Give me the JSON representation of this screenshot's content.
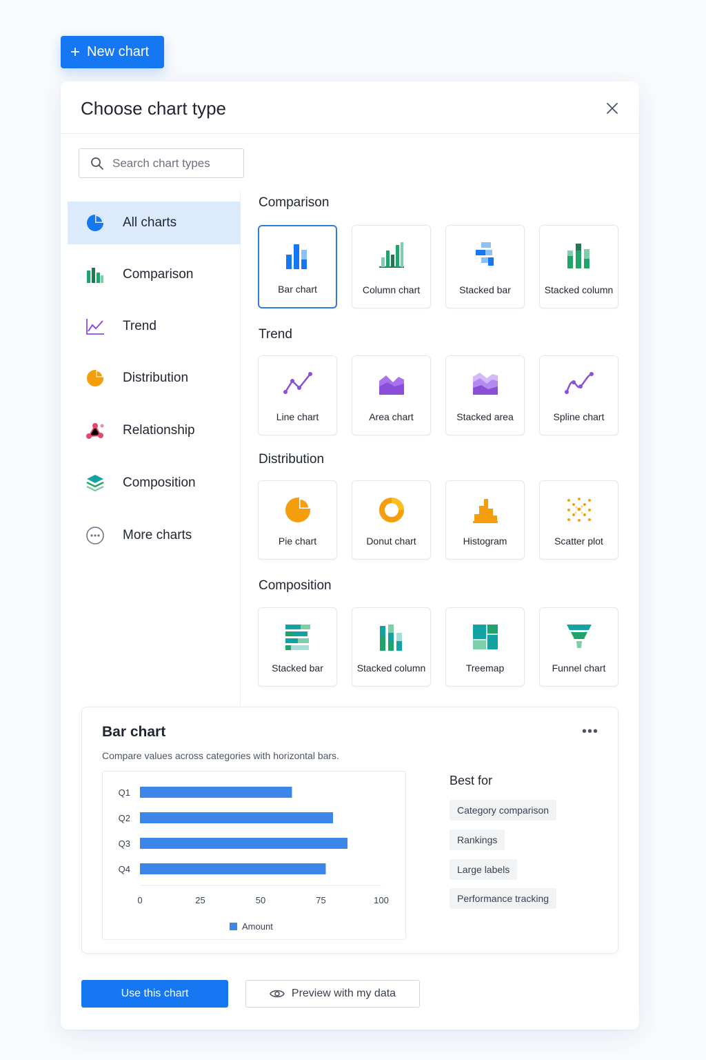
{
  "new_chart_button": {
    "label": "New chart",
    "icon": "plus-icon"
  },
  "dialog": {
    "title": "Choose chart type",
    "search": {
      "placeholder": "Search chart types",
      "value": ""
    },
    "sidebar": {
      "items": [
        {
          "label": "All charts",
          "icon": "pie-icon",
          "active": true
        },
        {
          "label": "Comparison",
          "icon": "bar-icon"
        },
        {
          "label": "Trend",
          "icon": "trend-icon"
        },
        {
          "label": "Distribution",
          "icon": "pie-icon"
        },
        {
          "label": "Relationship",
          "icon": "network-icon"
        },
        {
          "label": "Composition",
          "icon": "layers-icon"
        },
        {
          "label": "More charts",
          "icon": "more-icon"
        }
      ]
    },
    "sections": [
      {
        "title": "Comparison",
        "cards": [
          {
            "label": "Bar chart",
            "selected": true
          },
          {
            "label": "Column chart"
          },
          {
            "label": "Stacked bar"
          },
          {
            "label": "Stacked column"
          }
        ]
      },
      {
        "title": "Trend",
        "cards": [
          {
            "label": "Line chart"
          },
          {
            "label": "Area chart"
          },
          {
            "label": "Stacked area"
          },
          {
            "label": "Spline chart"
          }
        ]
      },
      {
        "title": "Distribution",
        "cards": [
          {
            "label": "Pie chart"
          },
          {
            "label": "Donut chart"
          },
          {
            "label": "Histogram"
          },
          {
            "label": "Scatter plot"
          }
        ]
      },
      {
        "title": "Composition",
        "cards": [
          {
            "label": "Stacked bar"
          },
          {
            "label": "Stacked column"
          },
          {
            "label": "Treemap"
          },
          {
            "label": "Funnel chart"
          }
        ]
      }
    ],
    "detail": {
      "title": "Bar chart",
      "description": "Compare values across categories with horizontal bars.",
      "best_for_title": "Best for",
      "tags": [
        "Category comparison",
        "Rankings",
        "Large labels",
        "Performance tracking"
      ]
    },
    "actions": {
      "use": "Use this chart",
      "preview": "Preview with my data"
    }
  },
  "colors": {
    "accent": "#1677f2",
    "bar": "#3b86e8",
    "comparison_green": "#21a46b",
    "trend_purple": "#8a4fd8",
    "distribution_orange": "#f59e0b",
    "relationship_pink": "#e04a6e",
    "composition_teal": "#14a3a3"
  },
  "chart_data": {
    "type": "bar",
    "orientation": "horizontal",
    "categories": [
      "Q1",
      "Q2",
      "Q3",
      "Q4"
    ],
    "series": [
      {
        "name": "Amount",
        "values": [
          63,
          80,
          86,
          77
        ]
      }
    ],
    "xlim": [
      0,
      100
    ],
    "xticks": [
      0,
      25,
      50,
      75,
      100
    ],
    "legend": "bottom-center",
    "grid": false
  }
}
